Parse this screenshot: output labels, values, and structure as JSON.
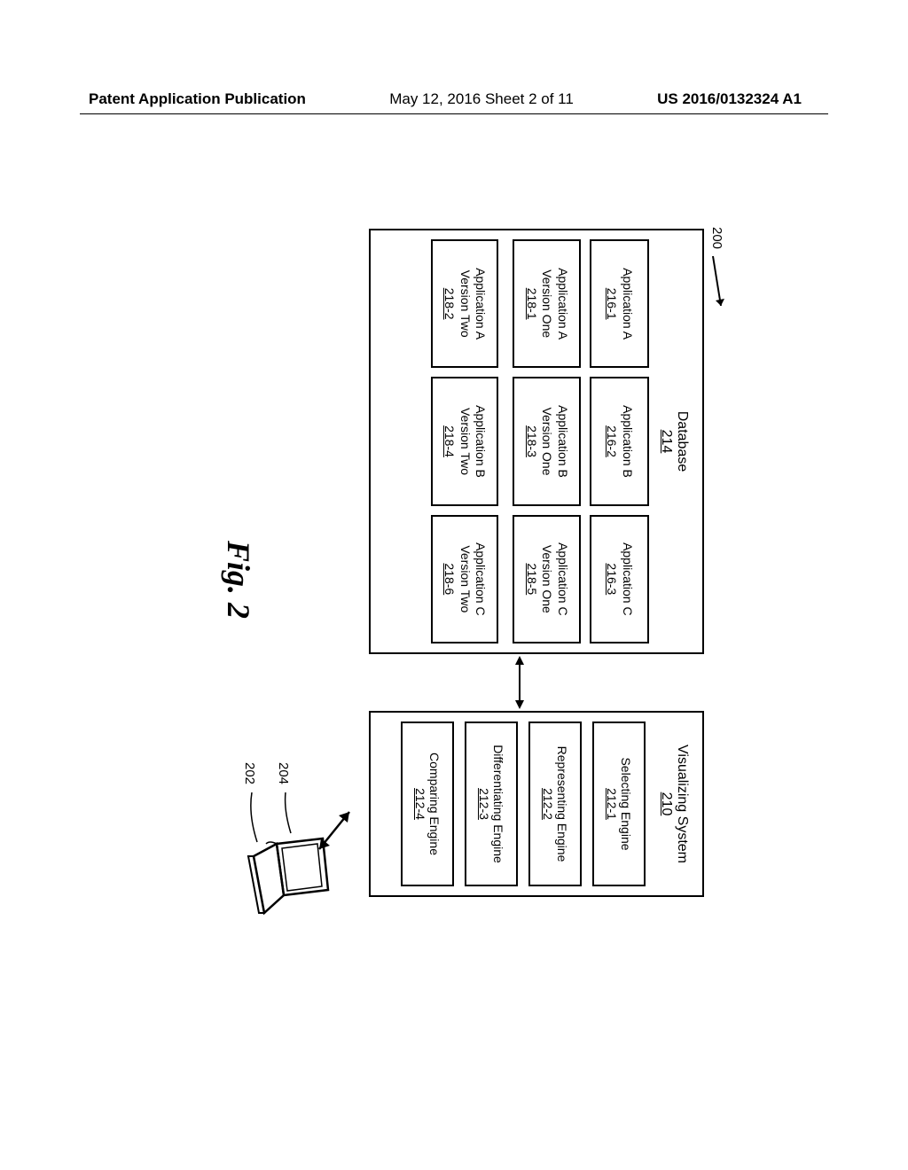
{
  "header": {
    "left": "Patent Application Publication",
    "mid": "May 12, 2016  Sheet 2 of 11",
    "right": "US 2016/0132324 A1"
  },
  "figure": {
    "label": "Fig. 2",
    "ref_number": "200",
    "database": {
      "title": "Database",
      "ref": "214",
      "columns": [
        {
          "app": {
            "name": "Application A",
            "ref": "216-1"
          },
          "v1": {
            "line1": "Application A",
            "line2": "Version One",
            "ref": "218-1"
          },
          "v2": {
            "line1": "Application A",
            "line2": "Version Two",
            "ref": "218-2"
          }
        },
        {
          "app": {
            "name": "Application B",
            "ref": "216-2"
          },
          "v1": {
            "line1": "Application B",
            "line2": "Version One",
            "ref": "218-3"
          },
          "v2": {
            "line1": "Application B",
            "line2": "Version Two",
            "ref": "218-4"
          }
        },
        {
          "app": {
            "name": "Application C",
            "ref": "216-3"
          },
          "v1": {
            "line1": "Application C",
            "line2": "Version One",
            "ref": "218-5"
          },
          "v2": {
            "line1": "Application C",
            "line2": "Version Two",
            "ref": "218-6"
          }
        }
      ]
    },
    "system": {
      "title": "Visualizing System",
      "ref": "210",
      "engines": [
        {
          "name": "Selecting Engine",
          "ref": "212-1"
        },
        {
          "name": "Representing Engine",
          "ref": "212-2"
        },
        {
          "name": "Differentiating Engine",
          "ref": "212-3"
        },
        {
          "name": "Comparing Engine",
          "ref": "212-4"
        }
      ]
    },
    "laptop": {
      "screen_ref": "204",
      "body_ref": "202"
    }
  }
}
